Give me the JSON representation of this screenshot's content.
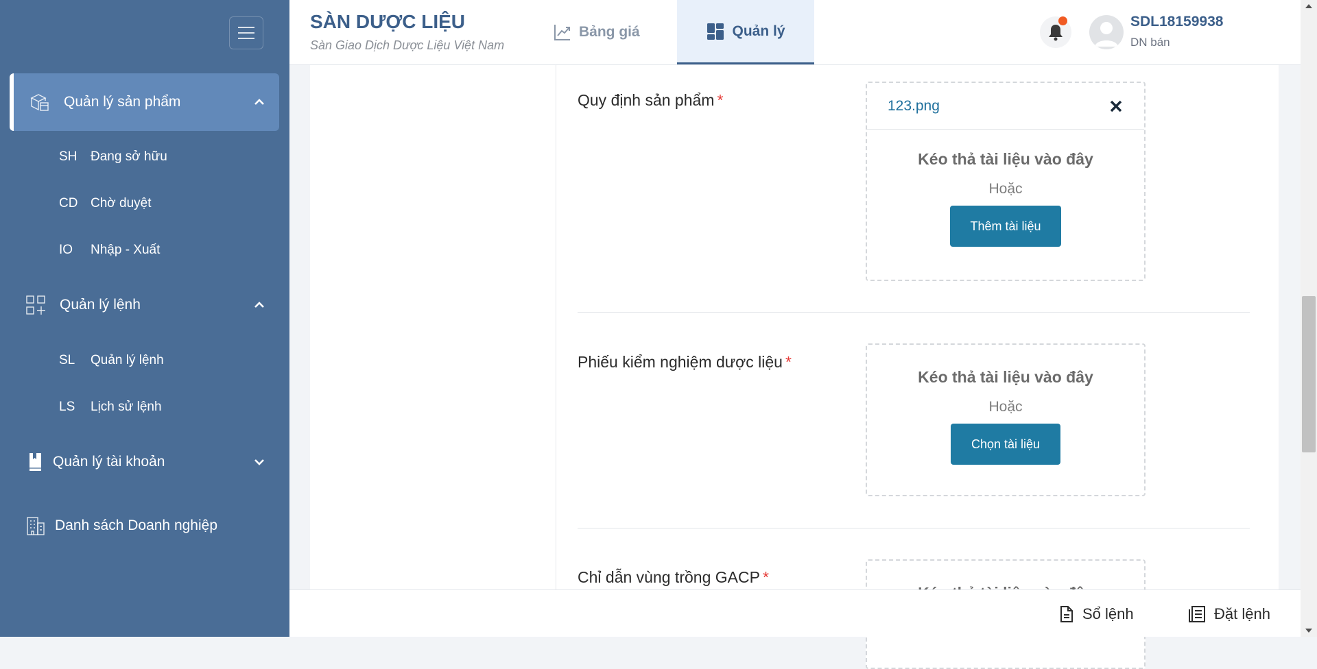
{
  "sidebar": {
    "groups": [
      {
        "label": "Quản lý sản phẩm",
        "icon": "boxes-icon",
        "expanded": true,
        "active": true,
        "items": [
          {
            "abbr": "SH",
            "label": "Đang sở hữu"
          },
          {
            "abbr": "CD",
            "label": "Chờ duyệt"
          },
          {
            "abbr": "IO",
            "label": "Nhập - Xuất"
          }
        ]
      },
      {
        "label": "Quản lý lệnh",
        "icon": "grid-plus-icon",
        "expanded": true,
        "items": [
          {
            "abbr": "SL",
            "label": "Quản lý lệnh"
          },
          {
            "abbr": "LS",
            "label": "Lịch sử lệnh"
          }
        ]
      },
      {
        "label": "Quản lý tài khoản",
        "icon": "account-book-icon",
        "expanded": false
      },
      {
        "label": "Danh sách Doanh nghiệp",
        "icon": "building-icon"
      }
    ]
  },
  "header": {
    "title": "SÀN DƯỢC LIỆU",
    "subtitle": "Sàn Giao Dịch Dược Liệu Việt Nam",
    "tabs": [
      {
        "label": "Bảng giá",
        "icon": "chart-line-icon",
        "active": false
      },
      {
        "label": "Quản lý",
        "icon": "dashboard-icon",
        "active": true
      }
    ],
    "user": {
      "id": "SDL18159938",
      "role": "DN bán"
    }
  },
  "form": {
    "fields": [
      {
        "label": "Quy định sản phẩm",
        "required_mark": "*",
        "file": "123.png",
        "drop_text": "Kéo thả tài liệu vào đây",
        "or_text": "Hoặc",
        "button": "Thêm tài liệu"
      },
      {
        "label": "Phiếu kiểm nghiệm dược liệu",
        "required_mark": "*",
        "drop_text": "Kéo thả tài liệu vào đây",
        "or_text": "Hoặc",
        "button": "Chọn tài liệu"
      },
      {
        "label": "Chỉ dẫn vùng trồng GACP",
        "required_mark": "*",
        "drop_text": "Kéo thả tài liệu vào đây"
      }
    ]
  },
  "bottom_bar": {
    "order_book": "Sổ lệnh",
    "place_order": "Đặt lệnh"
  },
  "colors": {
    "sidebar": "#4a6d96",
    "sidebar_active": "#6289b9",
    "brand": "#3c5f8a",
    "button": "#1f7ba3",
    "notification_dot": "#f05a22",
    "required": "#e53935"
  }
}
